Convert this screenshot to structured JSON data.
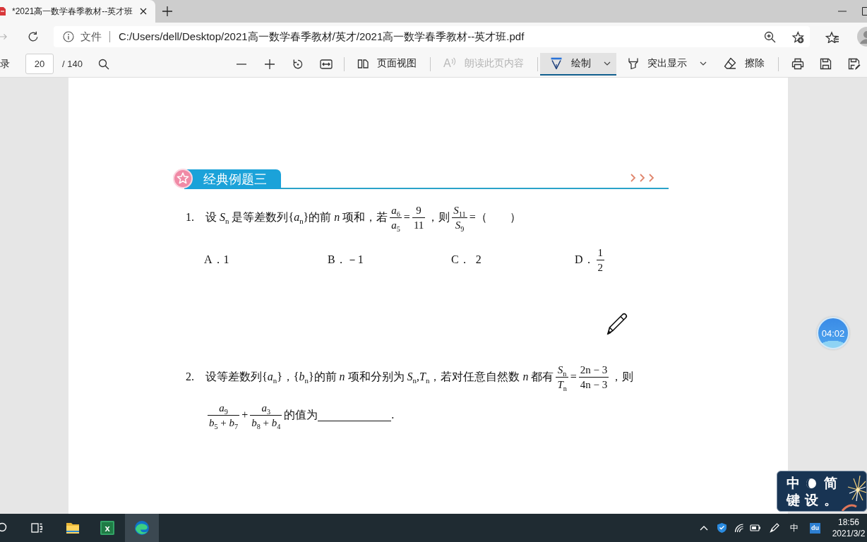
{
  "browser": {
    "tab": {
      "title": "*2021高一数学春季教材--英才班",
      "selected": true
    },
    "address_bar": {
      "scheme": "文件",
      "url": "C:/Users/dell/Desktop/2021高一数学春季教材/英才/2021高一数学春季教材--英才班.pdf"
    }
  },
  "pdf_toolbar": {
    "contents_label": "录",
    "page_number": "20",
    "page_count": "/ 140",
    "tools": [
      {
        "kind": "page_view",
        "label": "页面视图",
        "selected": false,
        "disabled": false,
        "dropdown": false
      },
      {
        "kind": "read_aloud",
        "glyph": "A",
        "label": "朗读此页内容",
        "selected": false,
        "disabled": true,
        "dropdown": false
      },
      {
        "kind": "draw",
        "label": "绘制",
        "selected": true,
        "disabled": false,
        "dropdown": true
      },
      {
        "kind": "highlight",
        "label": "突出显示",
        "selected": false,
        "disabled": false,
        "dropdown": true
      },
      {
        "kind": "erase",
        "label": "擦除",
        "selected": false,
        "disabled": false,
        "dropdown": false
      }
    ]
  },
  "document": {
    "section": {
      "title": "经典例题三"
    },
    "questions": [
      {
        "number": "1.",
        "lines": [
          [
            {
              "kind": "text",
              "text": "设 *S*$_{n}$ 是等差数列{*a*$_{n}$}的前 *n* 项和，若"
            },
            {
              "kind": "frac",
              "num": "*a*$_{6}$",
              "den": "*a*$_{5}$"
            },
            {
              "kind": "text",
              "text": "="
            },
            {
              "kind": "frac",
              "num": "9",
              "den": "11"
            },
            {
              "kind": "text",
              "text": "，则"
            },
            {
              "kind": "frac",
              "num": "*S*$_{11}$",
              "den": "*S*$_{9}$"
            },
            {
              "kind": "text",
              "text": "=（　　）"
            }
          ]
        ],
        "options": [
          {
            "segments": [
              {
                "kind": "text",
                "text": "A．1"
              }
            ]
          },
          {
            "segments": [
              {
                "kind": "text",
                "text": "B．－1"
              }
            ]
          },
          {
            "segments": [
              {
                "kind": "text",
                "text": "C．  2"
              }
            ]
          },
          {
            "segments": [
              {
                "kind": "text",
                "text": "D．"
              },
              {
                "kind": "frac",
                "num": "1",
                "den": "2"
              }
            ]
          }
        ]
      },
      {
        "number": "2.",
        "lines": [
          [
            {
              "kind": "text",
              "text": "设等差数列{*a*$_{n}$}，{*b*$_{n}$}的前 *n* 项和分别为 *S*$_{n}$,*T*$_{n}$，若对任意自然数 *n* 都有"
            },
            {
              "kind": "frac",
              "num": "*S*$_{n}$",
              "den": "*T*$_{n}$"
            },
            {
              "kind": "text",
              "text": "="
            },
            {
              "kind": "frac",
              "num": "2n − 3",
              "den": "4n − 3"
            },
            {
              "kind": "text",
              "text": "，则"
            }
          ],
          [
            {
              "kind": "frac",
              "num": "*a*$_{9}$",
              "den": "*b*$_{5}$ + *b*$_{7}$"
            },
            {
              "kind": "text",
              "text": "+"
            },
            {
              "kind": "frac",
              "num": "*a*$_{3}$",
              "den": "*b*$_{8}$ + *b*$_{4}$"
            },
            {
              "kind": "text",
              "text": "的值为"
            },
            {
              "kind": "blank"
            },
            {
              "kind": "text",
              "text": "."
            }
          ]
        ]
      }
    ]
  },
  "timer": {
    "time": "04:02"
  },
  "input_method": {
    "language": "中",
    "script": "简",
    "keyboard": "键",
    "settings": "设",
    "punctuation": "。"
  },
  "taskbar": {
    "apps": [
      {
        "kind": "folder",
        "selected": false
      },
      {
        "kind": "spreadsheet",
        "glyph": "x",
        "selected": false
      },
      {
        "kind": "browser",
        "selected": true
      }
    ],
    "tray": {
      "language": "中",
      "badge": "du"
    },
    "clock": {
      "time": "18:56",
      "date": "2021/3/2"
    }
  }
}
